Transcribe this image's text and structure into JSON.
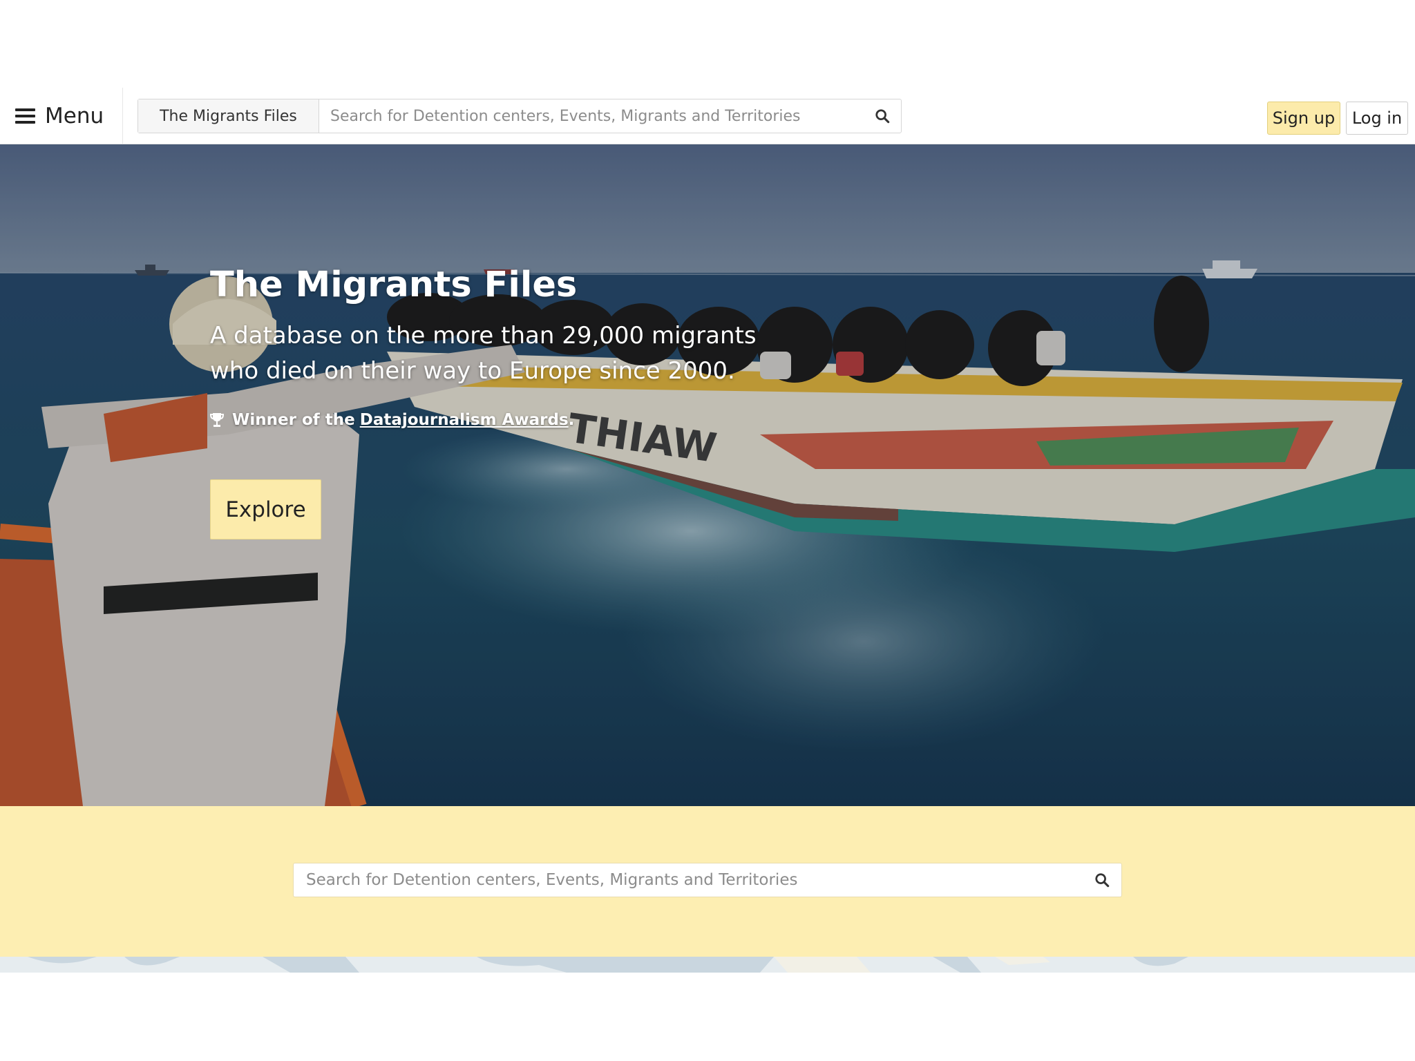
{
  "navbar": {
    "menu_label": "Menu",
    "scope_label": "The Migrants Files",
    "search_placeholder": "Search for Detention centers, Events, Migrants and Territories",
    "signup_label": "Sign up",
    "login_label": "Log in"
  },
  "hero": {
    "title": "The Migrants Files",
    "lead": "A database on the more than 29,000 migrants who died on their way to Europe since 2000.",
    "award_prefix": "Winner of the",
    "award_link": "Datajournalism Awards",
    "award_suffix": ".",
    "explore_label": "Explore"
  },
  "band": {
    "search_placeholder": "Search for Detention centers, Events, Migrants and Territories"
  },
  "icons": {
    "menu": "hamburger-icon",
    "search": "search-icon",
    "award": "trophy-icon"
  },
  "colors": {
    "accent_yellow": "#fcebab",
    "band_yellow": "#fdeeb2",
    "text_dark": "#222222"
  }
}
